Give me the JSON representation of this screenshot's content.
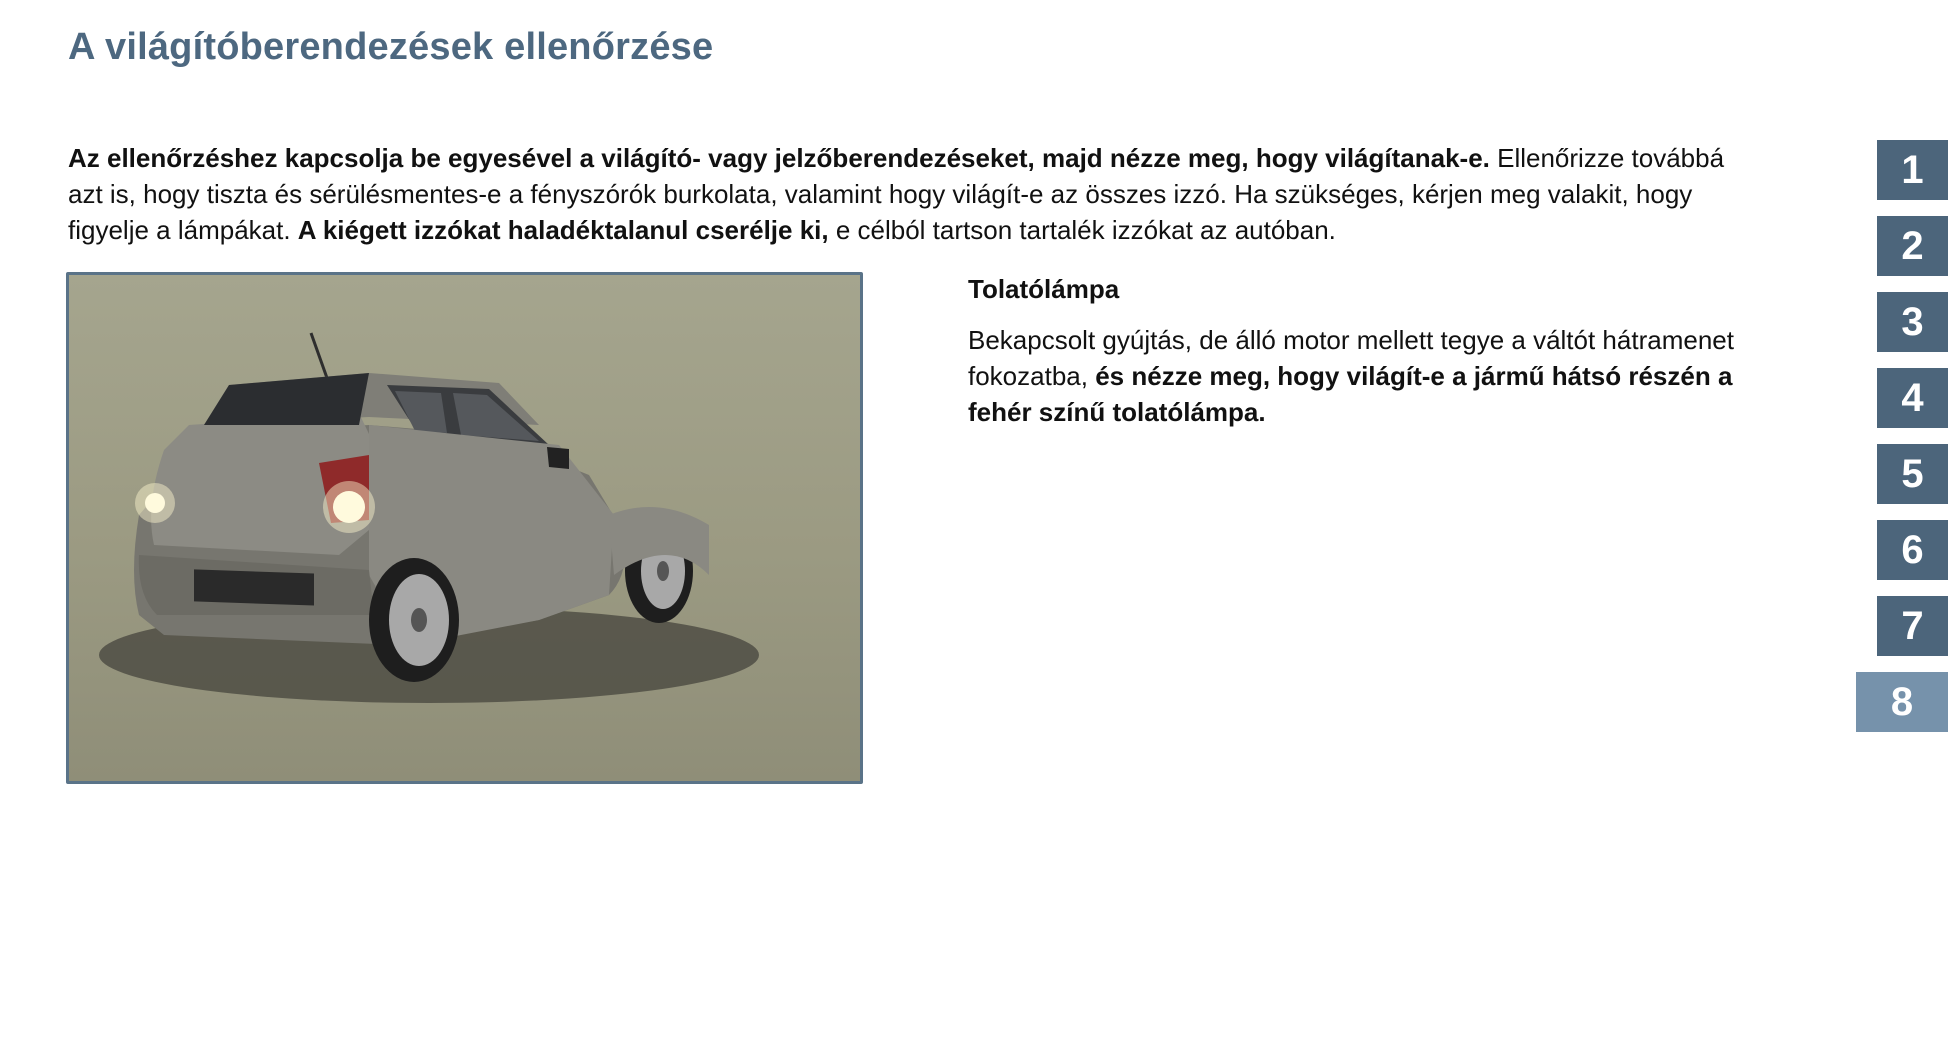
{
  "page": {
    "title": "A világítóberendezések ellenőrzése"
  },
  "intro": {
    "bold1": "Az ellenőrzéshez kapcsolja be egyesével a világító- vagy jelzőberendezéseket, majd nézze meg, hogy világítanak-e.",
    "text1": " Ellenőrizze továbbá azt is, hogy tiszta és sérülésmentes-e a fényszórók burkolata, valamint hogy világít-e az összes izzó. Ha szükséges, kérjen meg valakit, hogy figyelje a lámpákat. ",
    "bold2": "A kiégett izzókat haladéktalanul cserélje ki,",
    "text2": " e célból tartson tartalék izzókat az autóban."
  },
  "section": {
    "title": "Tolatólámpa",
    "text": "Bekapcsolt gyújtás, de álló motor mellett tegye a váltót hátramenet fokozatba, ",
    "bold": "és nézze meg, hogy világít-e a jármű hátsó részén a fehér színű tolatólámpa."
  },
  "nav": {
    "items": [
      {
        "label": "1",
        "active": false
      },
      {
        "label": "2",
        "active": false
      },
      {
        "label": "3",
        "active": false
      },
      {
        "label": "4",
        "active": false
      },
      {
        "label": "5",
        "active": false
      },
      {
        "label": "6",
        "active": false
      },
      {
        "label": "7",
        "active": false
      },
      {
        "label": "8",
        "active": true
      }
    ],
    "color": "#4c657b",
    "active_color": "#7692ab"
  },
  "image": {
    "subject": "grey hatchback car, rear view, reversing lights on"
  },
  "colors": {
    "title": "#4d6880",
    "image_border": "#5a7388"
  }
}
